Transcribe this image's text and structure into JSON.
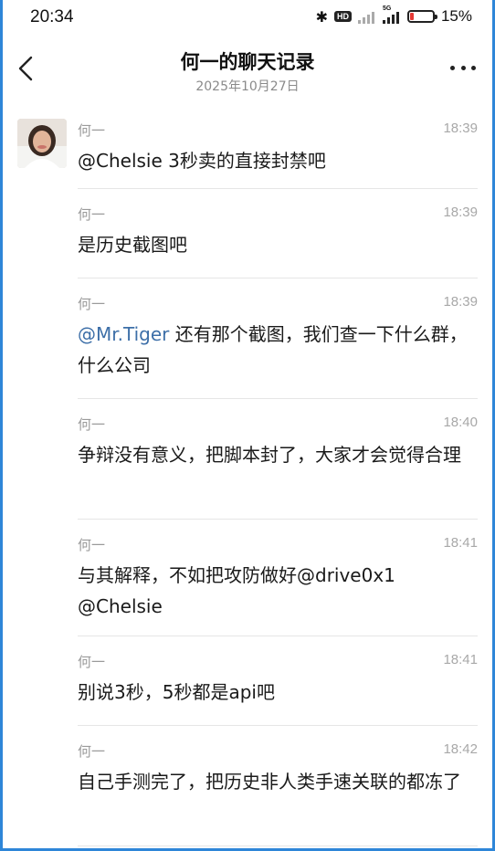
{
  "status_bar": {
    "time": "20:34",
    "network_label": "5G",
    "hd_label": "HD",
    "battery_percent": 15,
    "battery_text": "15%"
  },
  "header": {
    "title": "何一的聊天记录",
    "subtitle": "2025年10月27日"
  },
  "messages": [
    {
      "sender": "何一",
      "time": "18:39",
      "show_avatar": true,
      "mention": "",
      "text": "@Chelsie 3秒卖的直接封禁吧"
    },
    {
      "sender": "何一",
      "time": "18:39",
      "show_avatar": false,
      "mention": "",
      "text": "是历史截图吧"
    },
    {
      "sender": "何一",
      "time": "18:39",
      "show_avatar": false,
      "mention": "@Mr.Tiger",
      "text": " 还有那个截图，我们查一下什么群，什么公司"
    },
    {
      "sender": "何一",
      "time": "18:40",
      "show_avatar": false,
      "mention": "",
      "text": "争辩没有意义，把脚本封了，大家才会觉得合理"
    },
    {
      "sender": "何一",
      "time": "18:41",
      "show_avatar": false,
      "mention": "",
      "text": "与其解释，不如把攻防做好@drive0x1 @Chelsie"
    },
    {
      "sender": "何一",
      "time": "18:41",
      "show_avatar": false,
      "mention": "",
      "text": "别说3秒，5秒都是api吧"
    },
    {
      "sender": "何一",
      "time": "18:42",
      "show_avatar": false,
      "mention": "",
      "text": "自己手测完了，把历史非人类手速关联的都冻了"
    }
  ],
  "colors": {
    "border": "#2e86d8",
    "mention": "#3d6fa8",
    "battery_low": "#e53935"
  },
  "icons": [
    "back-icon",
    "more-icon",
    "bluetooth-icon",
    "signal-icon",
    "battery-icon"
  ]
}
